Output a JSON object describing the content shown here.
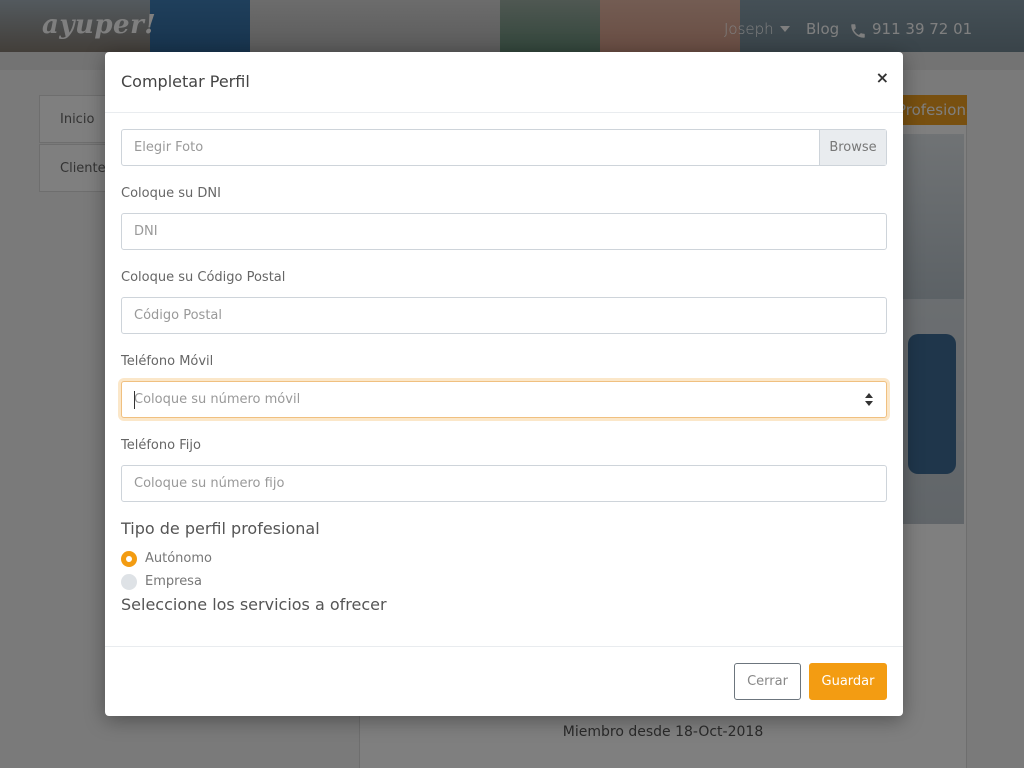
{
  "header": {
    "brand": "ayuper!",
    "user_name": "Joseph",
    "blog_link": "Blog",
    "phone": "911 39 72 01",
    "phone_icon": "phone-icon",
    "user_menu_icon": "chevron-down-icon"
  },
  "sidebar": {
    "items": [
      {
        "label": "Inicio"
      },
      {
        "label": "Clientes"
      }
    ]
  },
  "profile": {
    "tab_label": "Profesional",
    "member_since": "Miembro desde 18-Oct-2018"
  },
  "modal": {
    "title": "Completar Perfil",
    "close_symbol": "×",
    "photo": {
      "placeholder": "Elegir Foto",
      "browse_label": "Browse"
    },
    "dni": {
      "label": "Coloque su DNI",
      "placeholder": "DNI"
    },
    "postal": {
      "label": "Coloque su Código Postal",
      "placeholder": "Código Postal"
    },
    "mobile": {
      "label": "Teléfono Móvil",
      "placeholder": "Coloque su número móvil"
    },
    "landline": {
      "label": "Teléfono Fijo",
      "placeholder": "Coloque su número fijo"
    },
    "profile_type": {
      "title": "Tipo de perfil profesional",
      "options": [
        {
          "label": "Autónomo",
          "selected": true
        },
        {
          "label": "Empresa",
          "selected": false
        }
      ]
    },
    "services_title": "Seleccione los servicios a ofrecer",
    "footer": {
      "close_label": "Cerrar",
      "save_label": "Guardar"
    }
  },
  "colors": {
    "accent": "#f39c12",
    "overlay": "rgba(0,0,0,0.5)"
  }
}
